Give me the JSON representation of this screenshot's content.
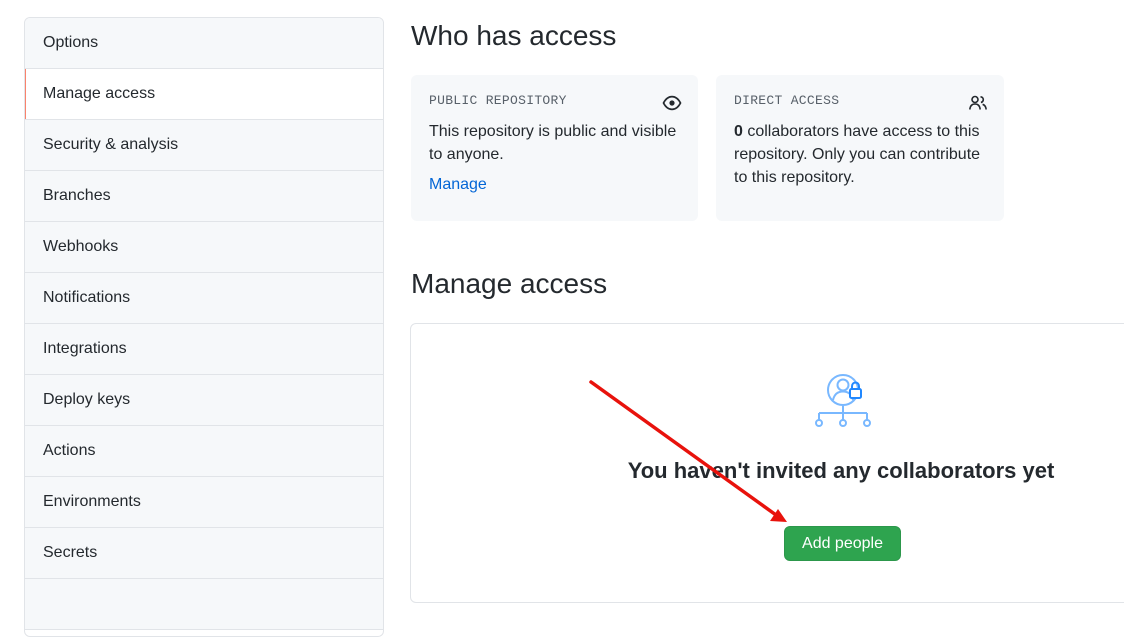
{
  "sidebar": {
    "items": [
      {
        "label": "Options"
      },
      {
        "label": "Manage access"
      },
      {
        "label": "Security & analysis"
      },
      {
        "label": "Branches"
      },
      {
        "label": "Webhooks"
      },
      {
        "label": "Notifications"
      },
      {
        "label": "Integrations"
      },
      {
        "label": "Deploy keys"
      },
      {
        "label": "Actions"
      },
      {
        "label": "Environments"
      },
      {
        "label": "Secrets"
      }
    ],
    "selected_index": 1
  },
  "who_has_access": {
    "title": "Who has access",
    "public_card": {
      "label": "PUBLIC REPOSITORY",
      "icon": "eye-icon",
      "text": "This repository is public and visible to anyone.",
      "link": "Manage"
    },
    "direct_card": {
      "label": "DIRECT ACCESS",
      "icon": "people-icon",
      "count": "0",
      "text": " collaborators have access to this repository. Only you can contribute to this repository."
    }
  },
  "manage_access": {
    "title": "Manage access",
    "icon": "person-lock-org-icon",
    "blankslate_title": "You haven't invited any collaborators yet",
    "add_button": "Add people"
  },
  "colors": {
    "accent_selected": "#f9826c",
    "link": "#0366d6",
    "primary_button": "#2ea44f",
    "annotation_arrow": "#e8120c"
  }
}
